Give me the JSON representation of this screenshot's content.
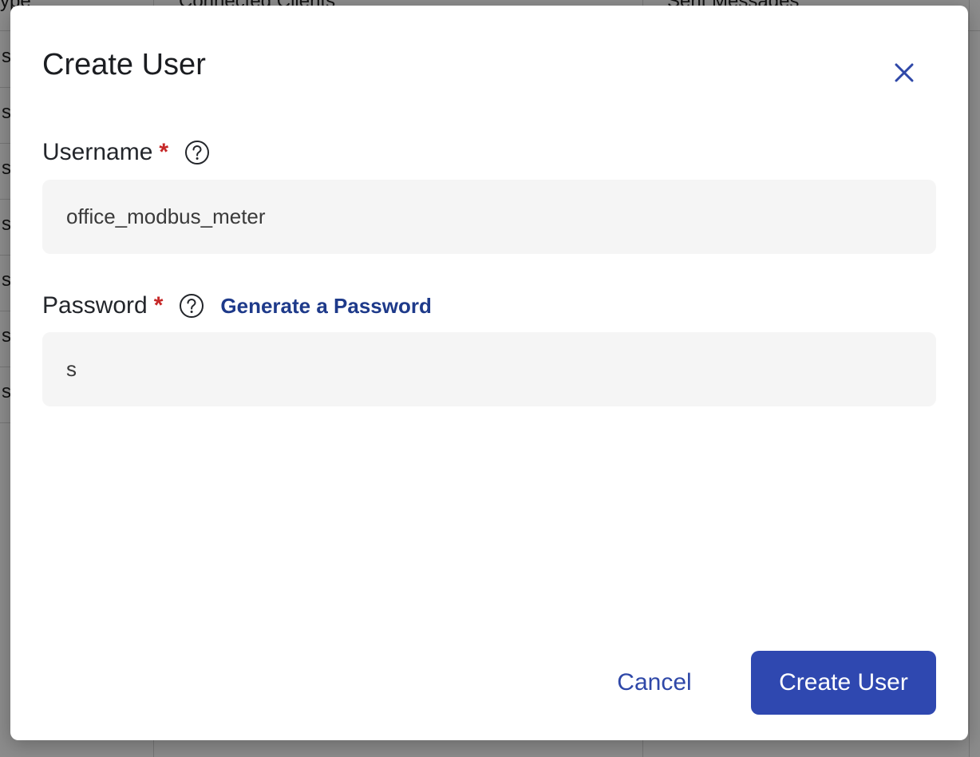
{
  "background_table": {
    "headers": [
      "ype",
      "Connected Clients",
      "Sent Messages"
    ],
    "rows": [
      "s",
      "s",
      "s",
      "s",
      "s",
      "s",
      "s"
    ]
  },
  "dialog": {
    "title": "Create User",
    "close_icon": "close-icon",
    "username": {
      "label": "Username",
      "required_mark": "*",
      "help_icon": "question-circle-icon",
      "value": "office_modbus_meter"
    },
    "password": {
      "label": "Password",
      "required_mark": "*",
      "help_icon": "question-circle-icon",
      "generate_link": "Generate a Password",
      "value": "s"
    },
    "cancel_label": "Cancel",
    "submit_label": "Create User"
  },
  "colors": {
    "primary": "#2f48b0",
    "link": "#1e3a8a",
    "required": "#c62828",
    "input_bg": "#f5f5f5"
  }
}
